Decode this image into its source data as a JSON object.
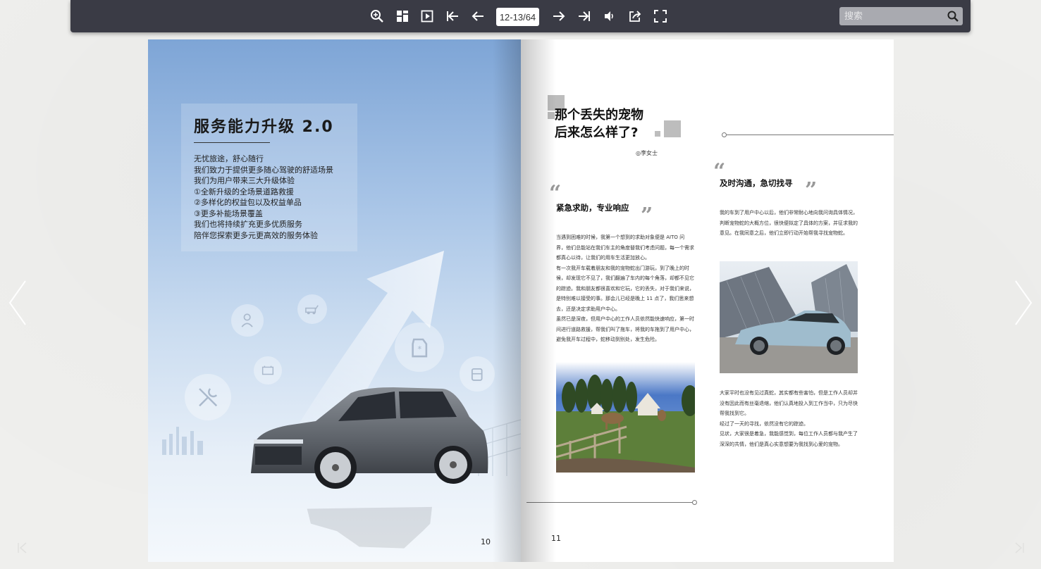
{
  "toolbar": {
    "page_indicator": "12-13/64",
    "search": {
      "placeholder": "搜索",
      "value": ""
    },
    "buttons": [
      {
        "name": "zoom-in-icon"
      },
      {
        "name": "thumbnails-icon"
      },
      {
        "name": "autoplay-icon"
      },
      {
        "name": "first-page-icon"
      },
      {
        "name": "prev-page-icon"
      },
      {
        "name": "next-page-icon"
      },
      {
        "name": "last-page-icon"
      },
      {
        "name": "sound-icon"
      },
      {
        "name": "share-icon"
      },
      {
        "name": "fullscreen-icon"
      }
    ]
  },
  "left_page": {
    "title": "服务能力升级 2.0",
    "lines": [
      "无忧旅途，舒心随行",
      "我们致力于提供更多随心驾驶的舒适场景",
      "我们为用户带来三大升级体验",
      "①全新升级的全场景道路救援",
      "②多样化的权益包以及权益单品",
      "③更多补能场景覆盖",
      "我们也将持续扩充更多优质服务",
      "陪伴您探索更多元更高效的服务体验"
    ],
    "page_number": "10"
  },
  "right_page": {
    "title_line1": "那个丢失的宠物",
    "title_line2": "后来怎么样了?",
    "author": "◎李女士",
    "section1": {
      "heading": "紧急求助，专业响应",
      "paragraphs": [
        "当遇到困难的时候，我第一个想到的求助对象便是 AITO 问界，他们总能站在我们车主的角度替我们考虑问题，每一个需求都真心以待，让我们的用车生活更加放心。",
        "有一次我开车载着朋友和我的宠物蛇出门游玩，到了晚上的时候，却发现它不见了，我们翻遍了车内的每个角落，却都不见它的踪迹。我和朋友都很喜欢和它玩，它的丢失，对于我们来说，是特别难以接受的事。那会儿已经是晚上 11 点了，我们思来想去，还是决定求助用户中心。",
        "虽然已是深夜，但用户中心的工作人员依然能快速响应，第一时间进行道路救援，帮我们叫了拖车，将我的车拖到了用户中心，避免我开车过程中，蛇移动到别处，发生危险。"
      ]
    },
    "section2": {
      "heading": "及时沟通，急切找寻",
      "paragraphs": [
        "我的车到了用户中心以后，他们非常耐心地向我问询具体情况，判断宠物蛇的大概方位，很快便拟定了具体的方案，并征求我的意见。在我同意之后，他们立即行动开始帮我寻找宠物蛇。"
      ],
      "paragraphs_after": [
        "大家平时也没有见过真蛇，其实都有些害怕，但是工作人员却并没有因此而有丝毫退缩，他们认真地投入到工作当中，只为尽快帮我找到它。",
        "经过了一天的寻找，依然没有它的踪迹。",
        "见状，大家很是着急，我能感觉到，每位工作人员都与我产生了深深的共情，他们是真心实意想要为我找到心爱的宠物。"
      ]
    },
    "page_number": "11"
  },
  "colors": {
    "toolbar_bg": "#3a3b45",
    "page_bg_blue": "#a6c3e6",
    "car_gray": "#6b7077",
    "car_blue": "#9fbccd"
  }
}
